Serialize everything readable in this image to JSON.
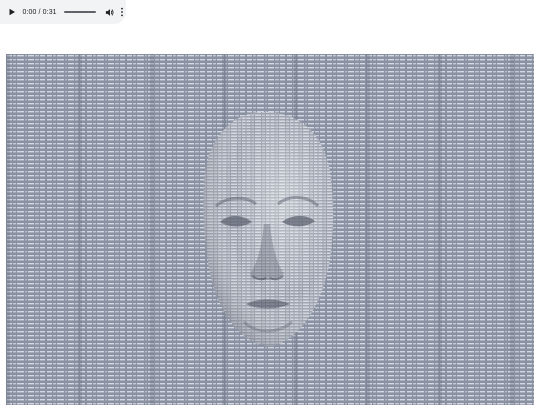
{
  "audio_player": {
    "current_time": "0:00",
    "separator": " / ",
    "duration": "0:31",
    "progress": 0,
    "icons": {
      "play": "play-icon",
      "volume": "volume-icon",
      "menu": "more-vert-icon"
    }
  },
  "artwork": {
    "subject": "face-mask-made-of-text",
    "colors": {
      "background": "#8a91a2",
      "text_light": "#d4d8e0",
      "text_dark": "#6b7282",
      "face_light": "#d8dbe2",
      "face_mid": "#a9aebb",
      "face_shadow": "#676d7b"
    }
  }
}
